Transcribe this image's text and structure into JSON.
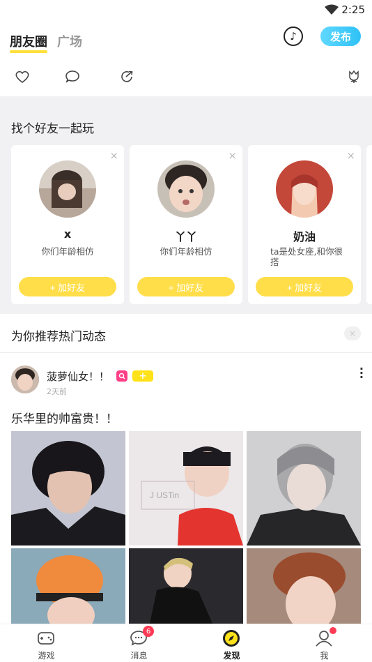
{
  "status_bar": {
    "time": "2:25"
  },
  "header": {
    "tabs": [
      {
        "label": "朋友圈"
      },
      {
        "label": "广场"
      }
    ],
    "publish_label": "发布"
  },
  "find_friends": {
    "title": "找个好友一起玩",
    "close_glyph": "×",
    "add_label": "+ 加好友",
    "cards": [
      {
        "name": "x",
        "desc": "你们年龄相仿"
      },
      {
        "name": "丫丫",
        "desc": "你们年龄相仿"
      },
      {
        "name": "奶油",
        "desc": "ta是处女座,和你很搭"
      }
    ]
  },
  "recommend": {
    "title": "为你推荐热门动态",
    "close_glyph": "×"
  },
  "post": {
    "author": "菠萝仙女！！",
    "time": "2天前",
    "text": "乐华里的帅富贵！！",
    "badge_plus": "+",
    "photo_caption": "J USTin"
  },
  "bottom_nav": {
    "items": [
      {
        "label": "游戏"
      },
      {
        "label": "消息",
        "badge": "6"
      },
      {
        "label": "发现"
      },
      {
        "label": "我"
      }
    ]
  },
  "colors": {
    "accent_yellow": "#ffde4a",
    "publish_blue": "#2fc1f5",
    "badge_red": "#ff3b55",
    "badge_pink": "#ff3f87"
  }
}
